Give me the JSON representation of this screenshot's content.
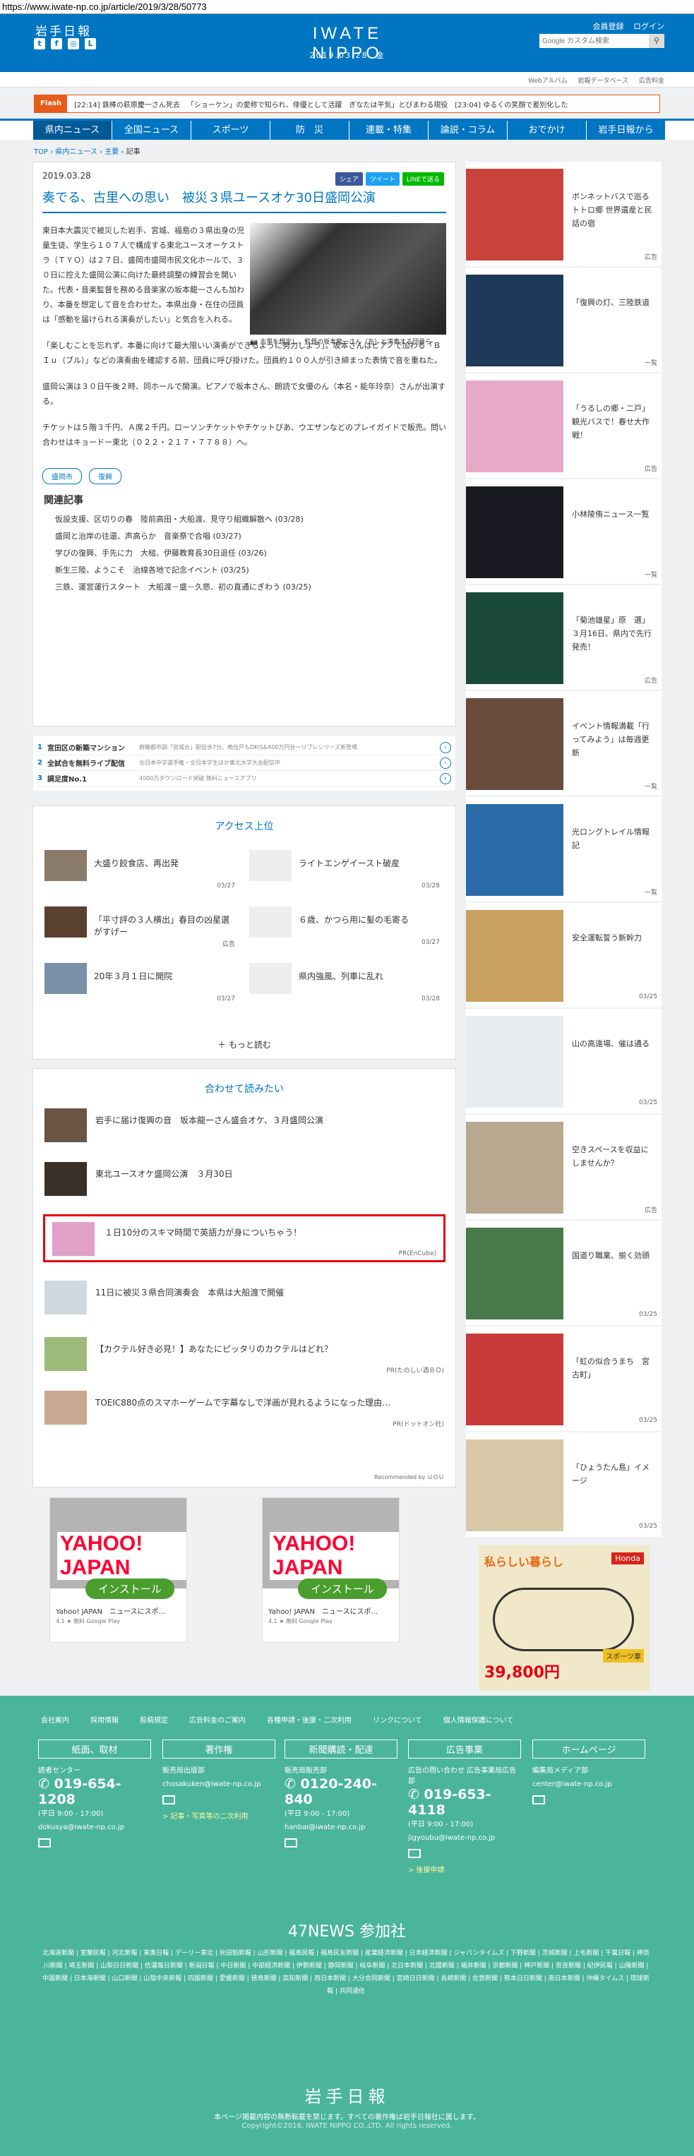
{
  "url": "https://www.iwate-np.co.jp/article/2019/3/28/50773",
  "header": {
    "logo_jp": "岩手日報",
    "brand": "IWATE NIPPO",
    "date": "2019.03.28. 金",
    "links": [
      "会員登録",
      "ログイン"
    ],
    "search_placeholder": "Google カスタム検索",
    "subnav": [
      "Webアルバム",
      "岩報データベース",
      "広告料金"
    ]
  },
  "flash": {
    "tag": "Flash",
    "items": [
      "[22:14] 鉄棒の萩原慶一さん死去",
      "「ショーケン」の愛称で知られ、俳優として活躍",
      "ぎなたは平気」とびまわる現役",
      "[23:04] ゆるくの笑顔で差別化した"
    ]
  },
  "gnav": [
    "県内ニュース",
    "全国ニュース",
    "スポーツ",
    "防　災",
    "連載・特集",
    "論説・コラム",
    "おでかけ",
    "岩手日報から"
  ],
  "breadcrumb": {
    "items": [
      "TOP",
      "県内ニュース",
      "主要"
    ],
    "current": "記事"
  },
  "article": {
    "date": "2019.03.28",
    "share": [
      "シェア",
      "ツイート",
      "LINEで送る"
    ],
    "title": "奏でる、古里への思い　被災３県ユースオケ30日盛岡公演",
    "photo_caption": "古里を想定し、監督の坂本龍一さん（左）と演奏する団員ら",
    "paragraphs": [
      "東日本大震災で被災した岩手、宮城、福島の３県出身の児童生徒、学生ら１０７人で構成する東北ユースオーケストラ（ＴＹＯ）は２７日、盛岡市盛岡市民文化ホールで、３０日に控えた盛岡公演に向けた最終調整の練習会を開いた。代表・音楽監督を務める音楽家の坂本龍一さんも加わり、本番を想定して音を合わせた。本県出身・在住の団員は「感動を届けられる演奏がしたい」と気合を入れる。",
      "「楽しむことを忘れず、本番に向けて最大限いい演奏ができるように努力しよう」。坂本さんはピアノで加わる「ＢＩｕ（ブル）」などの演奏曲を確認する前、団員に呼び掛けた。団員約１００人が引き締まった表情で音を重ねた。",
      "盛岡公演は３０日午後２時、同ホールで開演。ピアノで坂本さん、朗読で女優のん（本名・能年玲奈）さんが出演する。",
      "チケットは５階３千円、Ａ席２千円。ローソンチケットやチケットぴあ、ウエザンなどのプレイガイドで販売。問い合わせはキョードー東北（０２２・２１７・７７８８）へ。"
    ],
    "tags": [
      "盛岡市",
      "復興"
    ],
    "related_heading": "関連記事",
    "related": [
      "仮設支援、区切りの春　陸前高田・大船渡、見守り組織解散へ (03/28)",
      "盛岡と治岸の往還、声高らか　音楽祭で合唱 (03/27)",
      "学びの復興、手先に力　大槌、伊藤教育長30日退任 (03/26)",
      "新生三陸、ようこそ　治線各地で記念イベント (03/25)",
      "三鉄、運営運行スタート　大船渡－盛－久慈、初の直通にぎわう (03/25)"
    ]
  },
  "ads": [
    {
      "num": "1",
      "title": "宮田区の新築マンション",
      "desc": "俯瞰都市調「宮城台」駅徒歩7分。晩住戸もDKIS&400万円台〜リブレシリーズ新登場"
    },
    {
      "num": "2",
      "title": "全試合を無料ライブ配信",
      "desc": "全日本中学選手権・全日本学生ほか東北大学大会配信中"
    },
    {
      "num": "3",
      "title": "調足度No.1",
      "desc": "4000万ダウンロード突破 無料ニュースアプリ"
    }
  ],
  "access": {
    "heading": "アクセス上位",
    "items": [
      {
        "title": "大盛り餃食店、再出発",
        "date": "03/27"
      },
      {
        "title": "ライトエンゲイースト破産",
        "date": "03/28"
      },
      {
        "title": "「平寸評の３人横出」春目の凶星選がすげー",
        "date": "広告"
      },
      {
        "title": "６歳、かつら用に髪の毛寄る",
        "date": "03/27"
      },
      {
        "title": "20年３月１日に開院",
        "date": "03/27"
      },
      {
        "title": "県内強風、列車に乱れ",
        "date": "03/28"
      }
    ],
    "more": "もっと読む"
  },
  "reco": {
    "heading": "合わせて読みたい",
    "items": [
      {
        "title": "岩手に届け復興の音　坂本龍一さん盛会オケ、３月盛岡公演",
        "pr": ""
      },
      {
        "title": "東北ユースオケ盛岡公演　３月30日",
        "pr": ""
      },
      {
        "title": "１日10分のスキマ時間で英語力が身についちゃう！",
        "pr": "PR(EnCube)"
      },
      {
        "title": "11日に被災３県合同演奏会　本県は大船渡で開催",
        "pr": ""
      },
      {
        "title": "【カクテル好き必見！】あなたにピッタリのカクテルはどれ？",
        "pr": "PR(たのしい酒ＢＯ)"
      },
      {
        "title": "TOEIC880点のスマホーゲームで字幕なしで洋画が見れるようになった理由…",
        "pr": "PR(ドットオン社)"
      }
    ],
    "footer": "Recommended by ＵＯＵ"
  },
  "app_ads": [
    {
      "logo": "YAHOO! JAPAN",
      "install": "インストール",
      "name": "Yahoo! JAPAN　ニュースにスポ...",
      "meta": "4.1 ★ 無料  Google Play"
    },
    {
      "logo": "YAHOO! JAPAN",
      "install": "インストール",
      "name": "Yahoo! JAPAN　ニュースにスポ...",
      "meta": "4.1 ★ 無料  Google Play"
    }
  ],
  "side": [
    {
      "title": "ボンネットバスで巡るトトロ郷 世界遺産と民話の宿",
      "meta": "広告"
    },
    {
      "title": "「復興の灯、三陸鉄道",
      "meta": "一覧"
    },
    {
      "title": "「うるしの郷・二戸」観光バスで！春せ大作戦！",
      "meta": "広告"
    },
    {
      "title": "小林陵侑ニュース一覧",
      "meta": "一覧"
    },
    {
      "title": "「菊池雄星」原　選」３月16日、県内で先行発売！",
      "meta": "広告"
    },
    {
      "title": "イベント情報満載「行ってみよう」は毎週更新",
      "meta": "一覧"
    },
    {
      "title": "光ロングトレイル情報記",
      "meta": "一覧"
    },
    {
      "title": "安全運転誓う新幹力",
      "meta": "03/25"
    },
    {
      "title": "山の高遠場、催は通る",
      "meta": "03/25"
    },
    {
      "title": "空きスペースを収益にしませんか？",
      "meta": "広告"
    },
    {
      "title": "国道り職業、揃く効頭",
      "meta": "03/25"
    },
    {
      "title": "「虹の似合うまち　宮古町」",
      "meta": "03/25"
    },
    {
      "title": "「ひょうたん島」イメージ",
      "meta": "03/25"
    }
  ],
  "side_banner": {
    "text": "私らしい暮らし",
    "brand": "Honda",
    "price": "39,800円",
    "sub": "スポーツ車"
  },
  "footer": {
    "links": [
      "会社案内",
      "採用情報",
      "投稿規定",
      "広告料金のご案内",
      "各種申請・後援・二次利用",
      "リンクについて",
      "個人情報保護について"
    ],
    "cols": [
      {
        "head": "紙面、取材",
        "label": "読者センター",
        "tel": "019-654-1208",
        "hours": "(平日 9:00 - 17:00)",
        "mail": "dokusya@iwate-np.co.jp",
        "extra": ""
      },
      {
        "head": "著作権",
        "label": "販売局出版部",
        "tel": "",
        "hours": "",
        "mail": "chosakuken@iwate-np.co.jp",
        "extra": "> 記事・写真等の二次利用"
      },
      {
        "head": "新聞購読・配達",
        "label": "販売局販売部",
        "tel": "0120-240-840",
        "hours": "(平日 9:00 - 17:00)",
        "mail": "hanbai@iwate-np.co.jp",
        "extra": ""
      },
      {
        "head": "広告事業",
        "label": "広告の問い合わせ 広告事業局広告部",
        "tel": "019-653-4118",
        "hours": "(平日 9:00 - 17:00)",
        "mail": "jigyoubu@iwate-np.co.jp",
        "extra": "> 後援申請"
      },
      {
        "head": "ホームページ",
        "label": "編集局メディア部",
        "tel": "",
        "hours": "",
        "mail": "center@iwate-np.co.jp",
        "extra": ""
      }
    ],
    "n47_heading": "47NEWS 参加社",
    "n47": "北海道新聞 | 室蘭民報 | 河北新報 | 東奥日報 | デーリー東北 | 秋田魁新報 | 山形新聞 | 福島民報 | 福島民友新聞 | 産業経済新聞 | 日本経済新聞 | ジャパンタイムズ | 下野新聞 | 茨城新聞 | 上毛新聞 | 千葉日報 | 神奈川新聞 | 埼玉新聞 | 山梨日日新聞 | 信濃毎日新聞 | 新潟日報 | 中日新聞 | 中部経済新聞 | 伊勢新聞 | 静岡新聞 | 岐阜新聞 | 北日本新聞 | 北國新聞 | 福井新聞 | 京都新聞 | 神戸新聞 | 奈良新聞 | 紀伊民報 | 山陽新聞 | 中国新聞 | 日本海新聞 | 山口新聞 | 山陰中央新報 | 四国新聞 | 愛媛新聞 | 徳島新聞 | 高知新聞 | 西日本新聞 | 大分合同新聞 | 宮崎日日新聞 | 長崎新聞 | 佐賀新聞 | 熊本日日新聞 | 南日本新聞 | 沖縄タイムス | 琉球新報 | 共同通信",
    "logo": "岩手日報",
    "note": "本ページ掲載内容の無断転載を禁じます。すべての著作権は岩手日報社に属します。",
    "copy": "Copyright©2016, IWATE NIPPO CO.,LTD. All rights reserved."
  }
}
